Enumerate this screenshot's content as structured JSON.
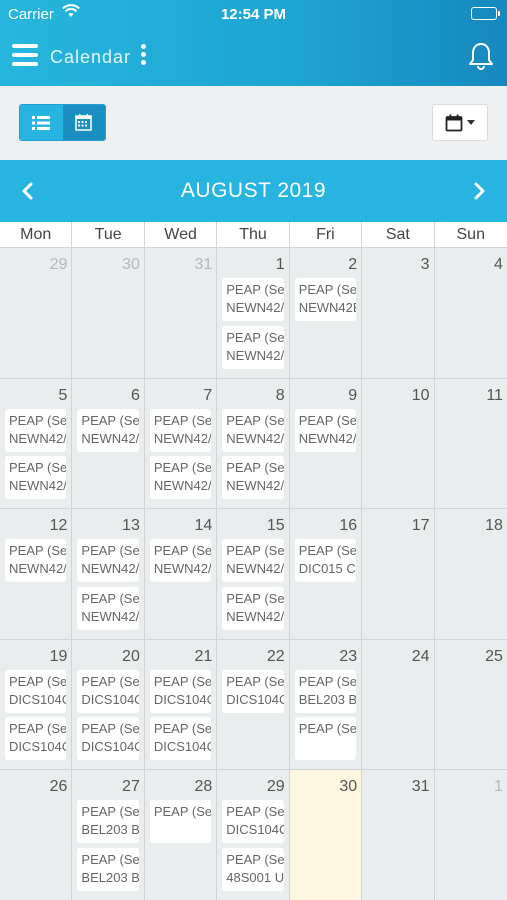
{
  "status_bar": {
    "carrier": "Carrier",
    "time": "12:54 PM"
  },
  "app_bar": {
    "title": "Calendar",
    "icons": [
      "menu-icon",
      "more-icon",
      "bell-icon"
    ]
  },
  "toolbar": {
    "view_modes": [
      "list-view",
      "calendar-view"
    ],
    "active_view": "calendar-view",
    "date_picker_icon": "calendar-icon"
  },
  "calendar": {
    "month_label": "AUGUST 2019",
    "weekdays": [
      "Mon",
      "Tue",
      "Wed",
      "Thu",
      "Fri",
      "Sat",
      "Sun"
    ],
    "today": "30",
    "weeks": [
      [
        {
          "day": "29",
          "other": true,
          "events": []
        },
        {
          "day": "30",
          "other": true,
          "events": []
        },
        {
          "day": "31",
          "other": true,
          "events": []
        },
        {
          "day": "1",
          "events": [
            {
              "l1": "PEAP (Se|",
              "l2": "NEWN42/"
            },
            {
              "l1": "PEAP (Se|",
              "l2": "NEWN42/"
            }
          ]
        },
        {
          "day": "2",
          "events": [
            {
              "l1": "PEAP (Se|",
              "l2": "NEWN42E"
            }
          ]
        },
        {
          "day": "3",
          "events": []
        },
        {
          "day": "4",
          "events": []
        }
      ],
      [
        {
          "day": "5",
          "events": [
            {
              "l1": "PEAP (Se|",
              "l2": "NEWN42/"
            },
            {
              "l1": "PEAP (Se|",
              "l2": "NEWN42/"
            }
          ]
        },
        {
          "day": "6",
          "events": [
            {
              "l1": "PEAP (Se|",
              "l2": "NEWN42/"
            }
          ]
        },
        {
          "day": "7",
          "events": [
            {
              "l1": "PEAP (Se|",
              "l2": "NEWN42/"
            },
            {
              "l1": "PEAP (Se|",
              "l2": "NEWN42/"
            }
          ]
        },
        {
          "day": "8",
          "events": [
            {
              "l1": "PEAP (Se|",
              "l2": "NEWN42/"
            },
            {
              "l1": "PEAP (Se|",
              "l2": "NEWN42/"
            }
          ]
        },
        {
          "day": "9",
          "events": [
            {
              "l1": "PEAP (Se|",
              "l2": "NEWN42/"
            }
          ]
        },
        {
          "day": "10",
          "events": []
        },
        {
          "day": "11",
          "events": []
        }
      ],
      [
        {
          "day": "12",
          "events": [
            {
              "l1": "PEAP (Se|",
              "l2": "NEWN42/"
            }
          ]
        },
        {
          "day": "13",
          "events": [
            {
              "l1": "PEAP (Se|",
              "l2": "NEWN42/"
            },
            {
              "l1": "PEAP (Se|",
              "l2": "NEWN42/"
            }
          ]
        },
        {
          "day": "14",
          "events": [
            {
              "l1": "PEAP (Se|",
              "l2": "NEWN42/"
            }
          ]
        },
        {
          "day": "15",
          "events": [
            {
              "l1": "PEAP (Se|",
              "l2": "NEWN42/"
            },
            {
              "l1": "PEAP (Se|",
              "l2": "NEWN42/"
            }
          ]
        },
        {
          "day": "16",
          "events": [
            {
              "l1": "PEAP (Se|",
              "l2": "DIC015 C"
            }
          ]
        },
        {
          "day": "17",
          "events": []
        },
        {
          "day": "18",
          "events": []
        }
      ],
      [
        {
          "day": "19",
          "events": [
            {
              "l1": "PEAP (Se|",
              "l2": "DICS104C"
            },
            {
              "l1": "PEAP (Se|",
              "l2": "DICS104C"
            }
          ]
        },
        {
          "day": "20",
          "events": [
            {
              "l1": "PEAP (Se|",
              "l2": "DICS104C"
            },
            {
              "l1": "PEAP (Se|",
              "l2": "DICS104C"
            }
          ]
        },
        {
          "day": "21",
          "events": [
            {
              "l1": "PEAP (Se|",
              "l2": "DICS104C"
            },
            {
              "l1": "PEAP (Se|",
              "l2": "DICS104C"
            }
          ]
        },
        {
          "day": "22",
          "events": [
            {
              "l1": "PEAP (Se|",
              "l2": "DICS104C"
            }
          ]
        },
        {
          "day": "23",
          "events": [
            {
              "l1": "PEAP (Se|",
              "l2": "BEL203 B"
            },
            {
              "l1": "PEAP (Se|",
              "l2": ""
            }
          ]
        },
        {
          "day": "24",
          "events": []
        },
        {
          "day": "25",
          "events": []
        }
      ],
      [
        {
          "day": "26",
          "events": []
        },
        {
          "day": "27",
          "events": [
            {
              "l1": "PEAP (Se|",
              "l2": "BEL203 B"
            },
            {
              "l1": "PEAP (Se|",
              "l2": "BEL203 B"
            }
          ]
        },
        {
          "day": "28",
          "events": [
            {
              "l1": "PEAP (Se|",
              "l2": ""
            }
          ]
        },
        {
          "day": "29",
          "events": [
            {
              "l1": "PEAP (Se|",
              "l2": "DICS104C"
            },
            {
              "l1": "PEAP (Se|",
              "l2": "48S001 U"
            }
          ]
        },
        {
          "day": "30",
          "events": []
        },
        {
          "day": "31",
          "events": []
        },
        {
          "day": "1",
          "other": true,
          "events": []
        }
      ]
    ]
  }
}
